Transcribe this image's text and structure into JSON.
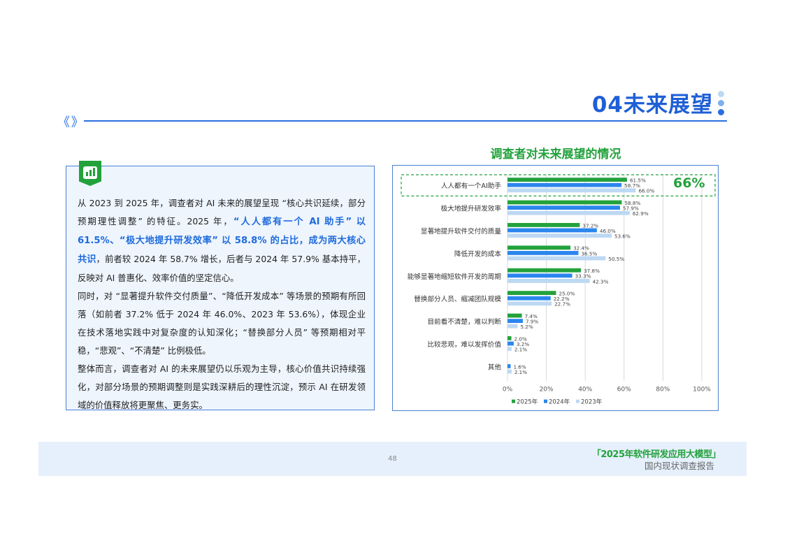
{
  "header": {
    "section_title": "04未来展望"
  },
  "text_panel": {
    "p1_a": "从 2023 到 2025 年，调查者对 AI 未来的展望呈现 “核心共识延续，部分预期理性调整” 的特征。2025 年，",
    "p1_hl": "“人人都有一个 AI 助手” 以 61.5%、“极大地提升研发效率” 以 58.8% 的占比，成为两大核心共识",
    "p1_b": "，前者较 2024 年 58.7% 增长，后者与 2024 年 57.9% 基本持平，反映对 AI 普惠化、效率价值的坚定信心。",
    "p2": "同时，对 “显著提升软件交付质量”、“降低开发成本” 等场景的预期有所回落（如前者 37.2% 低于 2024 年 46.0%、2023 年 53.6%），体现企业在技术落地实践中对复杂度的认知深化；“替换部分人员” 等预期相对平稳，“悲观”、“不清楚” 比例极低。",
    "p3": "整体而言，调查者对 AI 的未来展望仍以乐观为主导，核心价值共识持续强化，对部分场景的预期调整则是实践深耕后的理性沉淀，预示 AI 在研发领域的价值释放将更聚焦、更务实。"
  },
  "chart_data": {
    "type": "bar",
    "orientation": "horizontal",
    "title": "调查者对未来展望的情况",
    "categories": [
      "人人都有一个AI助手",
      "极大地提升研发效率",
      "显著地提升软件交付的质量",
      "降低开发的成本",
      "能够显著地缩短软件开发的周期",
      "替换部分人员、缩减团队规模",
      "目前看不清楚，难以判断",
      "比较悲观，难以发挥价值",
      "其他"
    ],
    "series": [
      {
        "name": "2025年",
        "color": "#23a23c",
        "values": [
          61.5,
          58.8,
          37.2,
          32.4,
          37.8,
          25.0,
          7.4,
          2.0,
          null
        ]
      },
      {
        "name": "2024年",
        "color": "#2b86ee",
        "values": [
          58.7,
          57.9,
          46.0,
          36.5,
          33.3,
          22.2,
          7.9,
          3.2,
          1.6
        ]
      },
      {
        "name": "2023年",
        "color": "#bcd8f3",
        "values": [
          66.0,
          62.9,
          53.6,
          50.5,
          42.3,
          22.7,
          5.2,
          2.1,
          2.1
        ]
      }
    ],
    "xlim": [
      0,
      100
    ],
    "xticks": [
      "0%",
      "20%",
      "40%",
      "60%",
      "80%",
      "100%"
    ],
    "legend_position": "bottom",
    "grid": true,
    "callout": "66%"
  },
  "footer": {
    "page_number": "48",
    "report_title": "「2025年软件研发应用大模型」",
    "report_subtitle": "国内现状调查报告"
  },
  "colors": {
    "brand_blue": "#1f5fd6",
    "brand_green": "#23a23c",
    "panel_bg": "#eef5fd"
  },
  "icons": {
    "badge": "bar-chart-icon",
    "nav": "double-chevron-icon"
  }
}
